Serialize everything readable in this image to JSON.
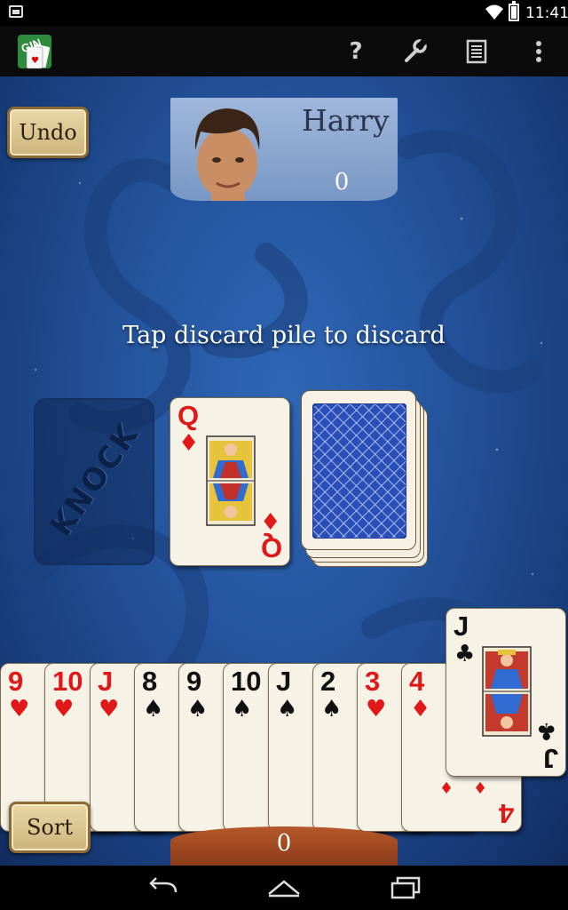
{
  "status_bar": {
    "time": "11:41"
  },
  "action_bar": {
    "app_icon": "gin-rummy-app-icon",
    "actions": [
      {
        "name": "help",
        "icon": "help-icon",
        "glyph": "?"
      },
      {
        "name": "settings",
        "icon": "wrench-icon"
      },
      {
        "name": "scores",
        "icon": "scoresheet-icon"
      },
      {
        "name": "overflow",
        "icon": "overflow-menu-icon"
      }
    ]
  },
  "buttons": {
    "undo": "Undo",
    "sort": "Sort"
  },
  "opponent": {
    "name": "Harry",
    "score": "0",
    "avatar": "opponent-avatar"
  },
  "message": "Tap discard pile to discard",
  "knock_label": "KNOCK",
  "discard_pile": {
    "rank": "Q",
    "suit": "♦",
    "color": "red"
  },
  "stock_pile": {
    "back_color": "#2b4fb8"
  },
  "hand": [
    {
      "rank": "9",
      "suit": "♥",
      "color": "red"
    },
    {
      "rank": "10",
      "suit": "♥",
      "color": "red"
    },
    {
      "rank": "J",
      "suit": "♥",
      "color": "red"
    },
    {
      "rank": "8",
      "suit": "♠",
      "color": "black"
    },
    {
      "rank": "9",
      "suit": "♠",
      "color": "black"
    },
    {
      "rank": "10",
      "suit": "♠",
      "color": "black"
    },
    {
      "rank": "J",
      "suit": "♠",
      "color": "black"
    },
    {
      "rank": "2",
      "suit": "♠",
      "color": "black"
    },
    {
      "rank": "3",
      "suit": "♥",
      "color": "red"
    },
    {
      "rank": "4",
      "suit": "♦",
      "color": "red"
    }
  ],
  "drawn_card": {
    "rank": "J",
    "suit": "♣",
    "color": "black"
  },
  "player_score": "0",
  "nav_bar": {
    "back": "back-icon",
    "home": "home-icon",
    "recents": "recents-icon"
  },
  "colors": {
    "felt": "#24549d",
    "red_suit": "#e01818",
    "card_face": "#f7f2e6"
  }
}
